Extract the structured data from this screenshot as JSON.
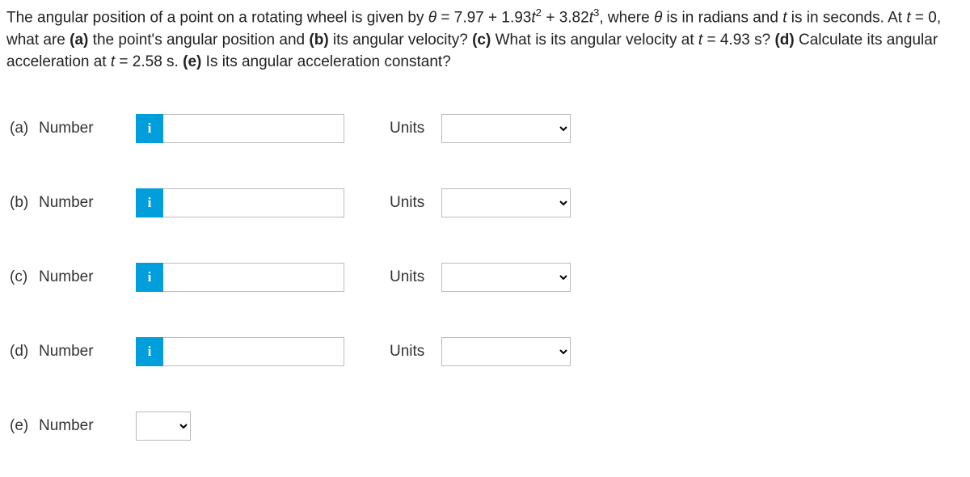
{
  "question": {
    "prefix": "The angular position of a point on a rotating wheel is given by ",
    "formula_theta": "θ",
    "formula_eq": " = 7.97 + 1.93",
    "formula_t2_base": "t",
    "formula_t2_exp": "2",
    "formula_plus": " + 3.82",
    "formula_t3_base": "t",
    "formula_t3_exp": "3",
    "after_formula": ", where ",
    "theta2": "θ",
    "after_theta2": " is in radians and ",
    "t_var": "t",
    "after_tvar": " is in seconds. At ",
    "t_eq0": "t",
    "eq0": " = 0, what are ",
    "part_a": "(a)",
    "a_text": " the point's angular position and ",
    "part_b": "(b)",
    "b_text": " its angular velocity? ",
    "part_c": "(c)",
    "c_text": " What is its angular velocity at ",
    "t_c": "t",
    "c_val": " = 4.93 s? ",
    "part_d": "(d)",
    "d_text": " Calculate its angular acceleration at ",
    "t_d": "t",
    "d_val": " = 2.58 s. ",
    "part_e": "(e)",
    "e_text": " Is its angular acceleration constant?"
  },
  "rows": {
    "a": {
      "part": "(a)",
      "label": "Number",
      "info": "i",
      "units": "Units"
    },
    "b": {
      "part": "(b)",
      "label": "Number",
      "info": "i",
      "units": "Units"
    },
    "c": {
      "part": "(c)",
      "label": "Number",
      "info": "i",
      "units": "Units"
    },
    "d": {
      "part": "(d)",
      "label": "Number",
      "info": "i",
      "units": "Units"
    },
    "e": {
      "part": "(e)",
      "label": "Number"
    }
  }
}
